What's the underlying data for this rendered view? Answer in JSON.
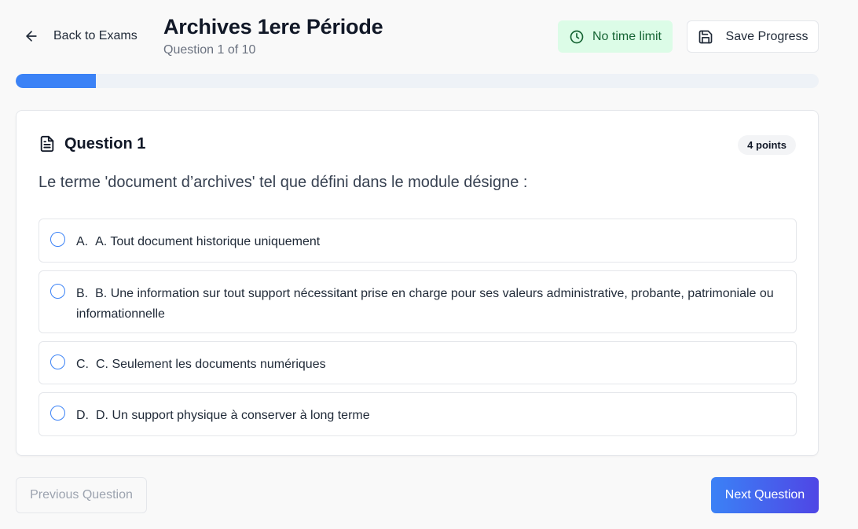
{
  "header": {
    "back_label": "Back to Exams",
    "title": "Archives 1ere Période",
    "subtitle": "Question 1 of 10",
    "time_label": "No time limit",
    "save_label": "Save Progress"
  },
  "progress": {
    "current": 1,
    "total": 10,
    "fraction": 0.1
  },
  "question": {
    "title": "Question 1",
    "points": "4 points",
    "text": "Le terme 'document d’archives' tel que défini dans le module désigne :",
    "options": [
      {
        "letter": "A.",
        "text": "A. Tout document historique uniquement"
      },
      {
        "letter": "B.",
        "text": "B. Une information sur tout support nécessitant prise en charge pour ses valeurs administrative, probante, patrimoniale ou informationnelle"
      },
      {
        "letter": "C.",
        "text": "C. Seulement les documents numériques"
      },
      {
        "letter": "D.",
        "text": "D. Un support physique à conserver à long terme"
      }
    ]
  },
  "footer": {
    "prev_label": "Previous Question",
    "next_label": "Next Question"
  },
  "colors": {
    "accent": "#3b82f6",
    "accent_end": "#4f46e5",
    "time_badge_bg": "#dcfce7",
    "time_badge_text": "#166534"
  },
  "icons": {
    "back": "arrow-left-icon",
    "clock": "clock-icon",
    "save": "save-icon",
    "question": "document-icon"
  }
}
